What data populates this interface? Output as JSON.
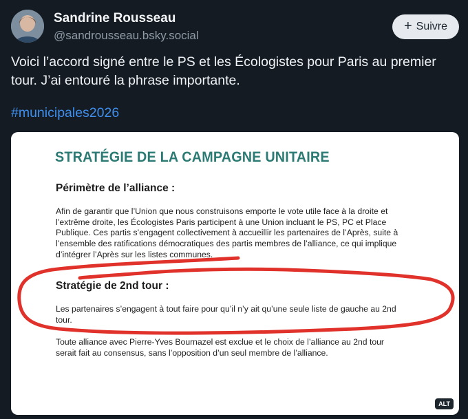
{
  "author": {
    "name": "Sandrine Rousseau",
    "handle": "@sandrousseau.bsky.social"
  },
  "follow": {
    "label": "Suivre",
    "icon": "plus-icon"
  },
  "post": {
    "text": "Voici l’accord signé entre le PS et les Écologistes pour Paris au premier tour. J’ai entouré la phrase importante.",
    "hashtag": "#municipales2026"
  },
  "document": {
    "title": "STRATÉGIE DE LA CAMPAGNE UNITAIRE",
    "sections": [
      {
        "heading": "Périmètre de l’alliance :",
        "lines": [
          "Afin de garantir que l’Union que nous construisons emporte le vote utile face à la droite et",
          "l’extrême droite, les Écologistes Paris participent à une Union incluant le PS, PC et Place",
          "Publique. Ces partis s’engagent collectivement à accueillir les partenaires de l’Après, suite à",
          "l’ensemble des ratifications démocratiques des partis membres de l’alliance, ce qui implique",
          "d’intégrer l’Après sur les listes communes."
        ]
      },
      {
        "heading": "Stratégie de 2nd tour :",
        "lines": [
          "Les partenaires s’engagent à tout faire pour qu’il n’y ait qu’une seule liste de gauche au 2nd",
          "tour."
        ]
      },
      {
        "heading": "",
        "lines": [
          "Toute alliance avec Pierre-Yves Bournazel est exclue et le choix de l’alliance au 2nd tour",
          "serait fait au consensus, sans l’opposition d’un seul membre de l’alliance."
        ]
      }
    ],
    "annotation_color": "#e0322a"
  },
  "alt_badge": "ALT"
}
